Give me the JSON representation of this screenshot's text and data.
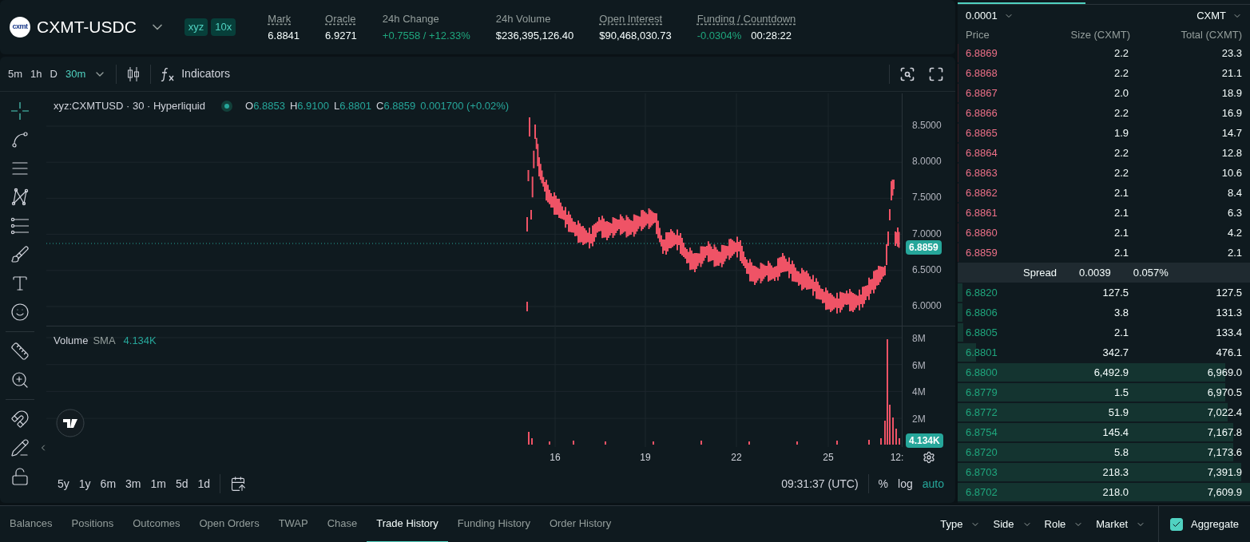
{
  "market": {
    "logo_text": "cxmt",
    "symbol": "CXMT-USDC",
    "tags": [
      "xyz",
      "10x"
    ]
  },
  "stats": [
    {
      "label": "Mark",
      "underlined": true,
      "values": [
        {
          "text": "6.8841",
          "highlighted": false
        }
      ]
    },
    {
      "label": "Oracle",
      "underlined": true,
      "values": [
        {
          "text": "6.9271",
          "highlighted": false
        }
      ]
    },
    {
      "label": "24h Change",
      "underlined": false,
      "values": [
        {
          "text": "+0.7558 / +12.33%",
          "highlighted": true
        }
      ]
    },
    {
      "label": "24h Volume",
      "underlined": false,
      "values": [
        {
          "text": "$236,395,126.40",
          "highlighted": false
        }
      ]
    },
    {
      "label": "Open Interest",
      "underlined": true,
      "values": [
        {
          "text": "$90,468,030.73",
          "highlighted": false
        }
      ]
    },
    {
      "label": "Funding / Countdown",
      "underlined": true,
      "values": [
        {
          "text": "-0.0304%",
          "highlighted": true
        },
        {
          "text": "00:28:22",
          "highlighted": false
        }
      ]
    }
  ],
  "chart_toolbar": {
    "intervals": [
      {
        "label": "5m",
        "selected": false
      },
      {
        "label": "1h",
        "selected": false
      },
      {
        "label": "D",
        "selected": false
      },
      {
        "label": "30m",
        "selected": true
      }
    ],
    "indicators": "Indicators"
  },
  "legend": {
    "title": "xyz:CXMTUSD · 30 · Hyperliquid",
    "ohlc": [
      {
        "key": "O",
        "value": "6.8853"
      },
      {
        "key": "H",
        "value": "6.9100"
      },
      {
        "key": "L",
        "value": "6.8801"
      },
      {
        "key": "C",
        "value": "6.8859"
      }
    ],
    "change": "0.001700 (+0.02%)"
  },
  "price_axis": [
    "8.5000",
    "8.0000",
    "7.5000",
    "7.0000",
    "6.5000",
    "6.0000"
  ],
  "last_price": "6.8859",
  "volume": {
    "label": "Volume",
    "sma": "SMA",
    "value": "4.134K",
    "axis": [
      "8M",
      "6M",
      "4M",
      "2M"
    ],
    "last": "4.134K"
  },
  "time_axis": [
    "16",
    "19",
    "22",
    "25",
    "12:"
  ],
  "ranges": [
    "5y",
    "1y",
    "6m",
    "3m",
    "1m",
    "5d",
    "1d"
  ],
  "clock": "09:31:37 (UTC)",
  "scale_options": [
    {
      "label": "%",
      "selected": false
    },
    {
      "label": "log",
      "selected": false
    },
    {
      "label": "auto",
      "selected": true
    }
  ],
  "order_book": {
    "tick": "0.0001",
    "unit": "CXMT",
    "columns": [
      "Price",
      "Size (CXMT)",
      "Total (CXMT)"
    ],
    "asks": [
      {
        "price": "6.8869",
        "size": "2.2",
        "total": "23.3",
        "level": 0.004
      },
      {
        "price": "6.8868",
        "size": "2.2",
        "total": "21.1",
        "level": 0.004
      },
      {
        "price": "6.8867",
        "size": "2.0",
        "total": "18.9",
        "level": 0.004
      },
      {
        "price": "6.8866",
        "size": "2.2",
        "total": "16.9",
        "level": 0.004
      },
      {
        "price": "6.8865",
        "size": "1.9",
        "total": "14.7",
        "level": 0.004
      },
      {
        "price": "6.8864",
        "size": "2.2",
        "total": "12.8",
        "level": 0.004
      },
      {
        "price": "6.8863",
        "size": "2.2",
        "total": "10.6",
        "level": 0.004
      },
      {
        "price": "6.8862",
        "size": "2.1",
        "total": "8.4",
        "level": 0.004
      },
      {
        "price": "6.8861",
        "size": "2.1",
        "total": "6.3",
        "level": 0.004
      },
      {
        "price": "6.8860",
        "size": "2.1",
        "total": "4.2",
        "level": 0.004
      },
      {
        "price": "6.8859",
        "size": "2.1",
        "total": "2.1",
        "level": 0.004
      }
    ],
    "spread": {
      "label": "Spread",
      "value": "0.0039",
      "percent": "0.057%"
    },
    "bids": [
      {
        "price": "6.8820",
        "size": "127.5",
        "total": "127.5",
        "level": 0.017
      },
      {
        "price": "6.8806",
        "size": "3.8",
        "total": "131.3",
        "level": 0.017
      },
      {
        "price": "6.8805",
        "size": "2.1",
        "total": "133.4",
        "level": 0.018
      },
      {
        "price": "6.8801",
        "size": "342.7",
        "total": "476.1",
        "level": 0.063
      },
      {
        "price": "6.8800",
        "size": "6,492.9",
        "total": "6,969.0",
        "level": 0.916
      },
      {
        "price": "6.8779",
        "size": "1.5",
        "total": "6,970.5",
        "level": 0.916
      },
      {
        "price": "6.8772",
        "size": "51.9",
        "total": "7,022.4",
        "level": 0.923
      },
      {
        "price": "6.8754",
        "size": "145.4",
        "total": "7,167.8",
        "level": 0.942
      },
      {
        "price": "6.8720",
        "size": "5.8",
        "total": "7,173.6",
        "level": 0.943
      },
      {
        "price": "6.8703",
        "size": "218.3",
        "total": "7,391.9",
        "level": 0.971
      },
      {
        "price": "6.8702",
        "size": "218.0",
        "total": "7,609.9",
        "level": 1.0
      }
    ]
  },
  "bottom_tabs": [
    {
      "label": "Balances",
      "selected": false
    },
    {
      "label": "Positions",
      "selected": false
    },
    {
      "label": "Outcomes",
      "selected": false
    },
    {
      "label": "Open Orders",
      "selected": false
    },
    {
      "label": "TWAP",
      "selected": false
    },
    {
      "label": "Chase",
      "selected": false
    },
    {
      "label": "Trade History",
      "selected": true
    },
    {
      "label": "Funding History",
      "selected": false
    },
    {
      "label": "Order History",
      "selected": false
    }
  ],
  "filters": [
    "Type",
    "Side",
    "Role",
    "Market"
  ],
  "aggregate": {
    "label": "Aggregate",
    "checked": true
  }
}
